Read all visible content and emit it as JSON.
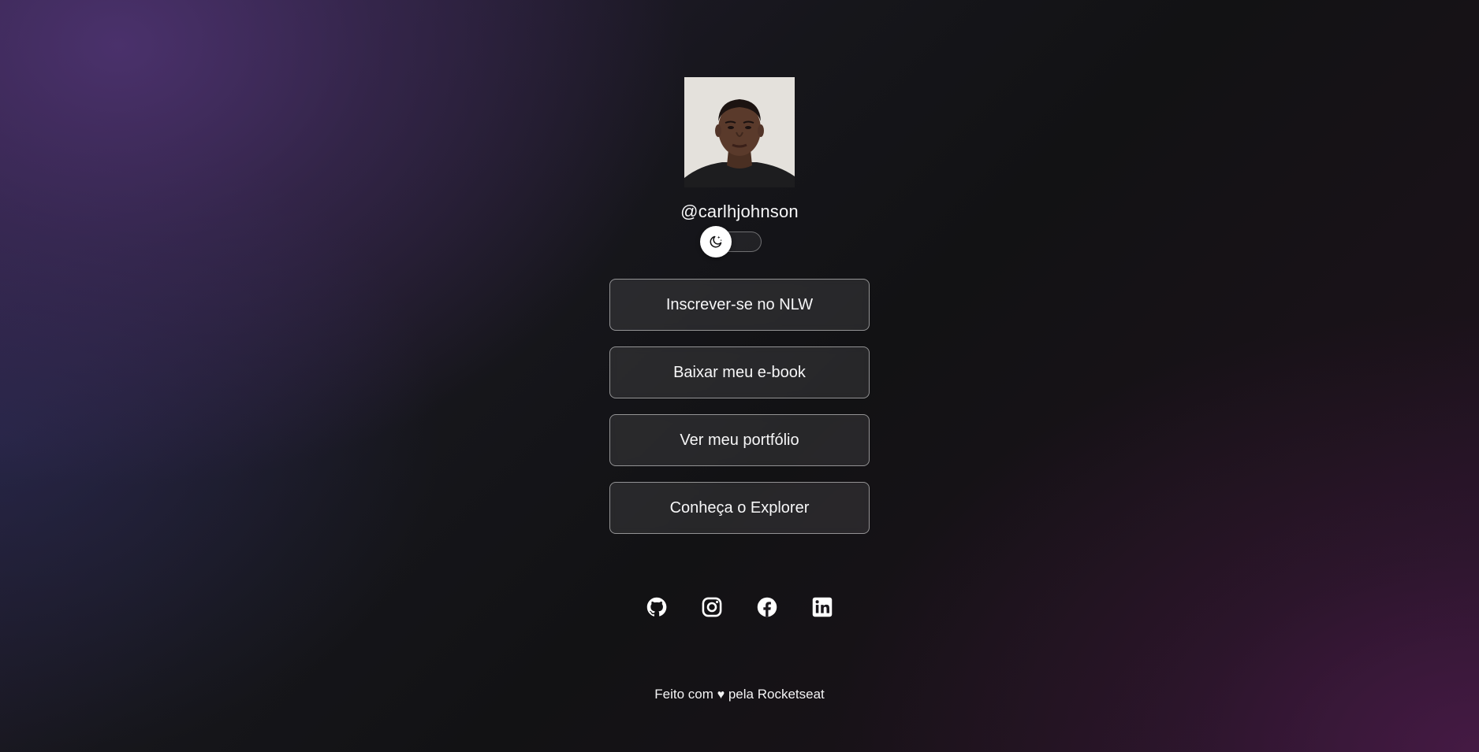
{
  "profile": {
    "username": "@carlhjohnson"
  },
  "theme_switch": {
    "icon": "moon-stars-icon"
  },
  "links": [
    {
      "label": "Inscrever-se no NLW"
    },
    {
      "label": "Baixar meu e-book"
    },
    {
      "label": "Ver meu portfólio"
    },
    {
      "label": "Conheça o Explorer"
    }
  ],
  "social": [
    {
      "icon": "github-icon"
    },
    {
      "icon": "instagram-icon"
    },
    {
      "icon": "facebook-icon"
    },
    {
      "icon": "linkedin-icon"
    }
  ],
  "footer": {
    "prefix": "Feito com",
    "heart": "♥",
    "suffix": "pela Rocketseat"
  },
  "colors": {
    "background": "#121214",
    "text": "#f4f4f5",
    "button_border": "#ffffff80",
    "gradient_purple": "#4c326e",
    "gradient_magenta": "#501c4e"
  }
}
